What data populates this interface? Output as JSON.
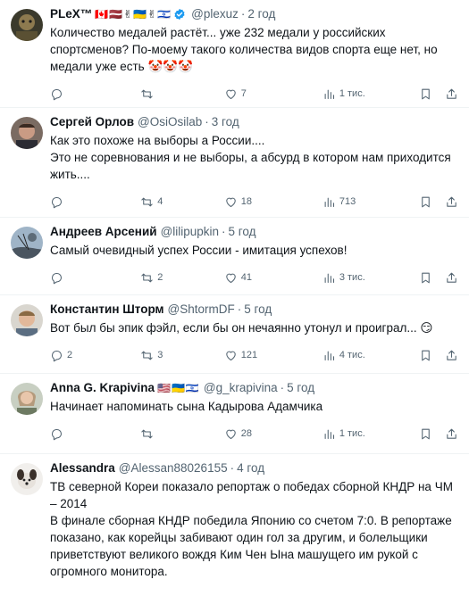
{
  "tweets": [
    {
      "name": "PLeX™",
      "flags": "🇨🇦🇱🇻✌🇺🇦✌🇮🇱",
      "handle": "@plexuz",
      "time": "2 год",
      "lines": [
        "Количество медалей растёт... уже 232 медали у российских",
        "спортсменов? По-моему такого количества видов спорта еще нет, но",
        "медали уже есть 🤡🤡🤡"
      ],
      "reply": "",
      "retweet": "",
      "like": "7",
      "views": "1 тис."
    },
    {
      "name": "Сергей Орлов",
      "handle": "@OsiOsilab",
      "time": "3 год",
      "lines": [
        "Как это похоже на выборы а России....",
        "Это не соревнования и не выборы, а абсурд в котором нам приходится",
        "жить...."
      ],
      "reply": "",
      "retweet": "4",
      "like": "18",
      "views": "713"
    },
    {
      "name": "Андреев Арсений",
      "handle": "@lilipupkin",
      "time": "5 год",
      "lines": [
        "Самый очевидный успех России - имитация успехов!"
      ],
      "reply": "",
      "retweet": "2",
      "like": "41",
      "views": "3 тис."
    },
    {
      "name": "Константин Шторм",
      "handle": "@ShtormDF",
      "time": "5 год",
      "lines": [
        "Вот был бы эпик фэйл, если бы он нечаянно утонул и проиграл... 😏"
      ],
      "reply": "2",
      "retweet": "3",
      "like": "121",
      "views": "4 тис."
    },
    {
      "name": "Anna G. Krapivina",
      "flags": "🇺🇸🇺🇦🇮🇱",
      "handle": "@g_krapivina",
      "time": "5 год",
      "lines": [
        "Начинает напоминать сына Кадырова Адамчика"
      ],
      "reply": "",
      "retweet": "",
      "like": "28",
      "views": "1 тис."
    },
    {
      "name": "Alessandra",
      "handle": "@Alessan88026155",
      "time": "4 год",
      "lines": [
        "ТВ северной Кореи показало репортаж о победах сборной КНДР на ЧМ",
        "– 2014",
        "В финале сборная КНДР победила Японию со счетом 7:0. В репортаже",
        "показано, как корейцы забивают один гол за другим, и болельщики",
        "приветствуют великого вождя Ким Чен Ына машущего им рукой с",
        "огромного монитора."
      ],
      "reply": "",
      "retweet": "",
      "like": "",
      "views": ""
    }
  ],
  "colors": {
    "text": "#0f1419",
    "muted": "#536471",
    "verified": "#1d9bf0",
    "divider": "#eff3f4"
  }
}
